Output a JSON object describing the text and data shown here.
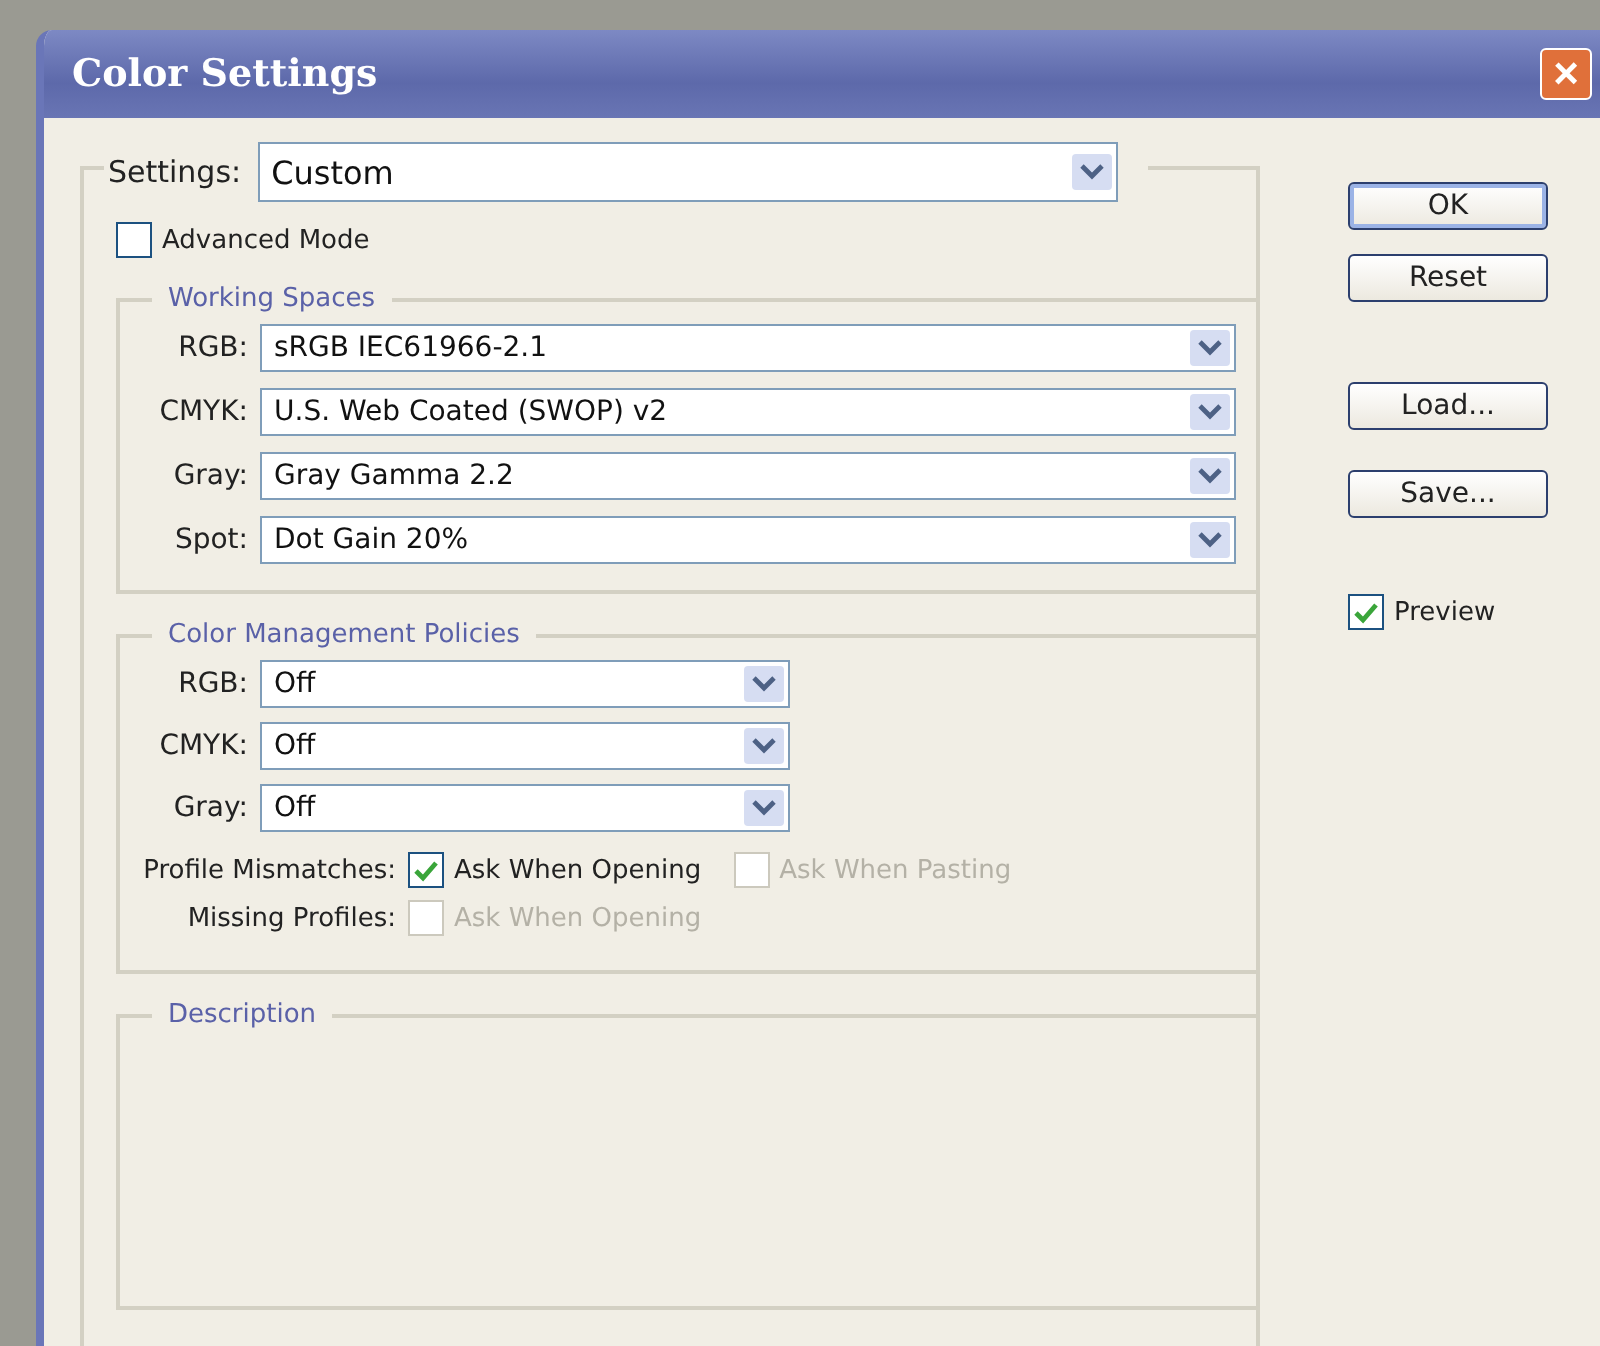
{
  "window": {
    "title": "Color Settings",
    "close": "×"
  },
  "settings": {
    "label": "Settings:",
    "value": "Custom"
  },
  "advanced_mode": {
    "label": "Advanced Mode",
    "checked": false
  },
  "working_spaces": {
    "title": "Working Spaces",
    "rows": [
      {
        "label": "RGB:",
        "value": "sRGB IEC61966-2.1"
      },
      {
        "label": "CMYK:",
        "value": "U.S. Web Coated (SWOP) v2"
      },
      {
        "label": "Gray:",
        "value": "Gray Gamma 2.2"
      },
      {
        "label": "Spot:",
        "value": "Dot Gain 20%"
      }
    ]
  },
  "policies": {
    "title": "Color Management Policies",
    "rows": [
      {
        "label": "RGB:",
        "value": "Off"
      },
      {
        "label": "CMYK:",
        "value": "Off"
      },
      {
        "label": "Gray:",
        "value": "Off"
      }
    ],
    "options": [
      {
        "label": "Profile Mismatches:",
        "checks": [
          {
            "label": "Ask When Opening",
            "checked": true,
            "disabled": false
          },
          {
            "label": "Ask When Pasting",
            "checked": false,
            "disabled": true
          }
        ]
      },
      {
        "label": "Missing Profiles:",
        "checks": [
          {
            "label": "Ask When Opening",
            "checked": false,
            "disabled": true
          }
        ]
      }
    ]
  },
  "description": {
    "title": "Description"
  },
  "buttons": [
    {
      "label": "OK",
      "default": true
    },
    {
      "label": "Reset",
      "default": false
    },
    {
      "label": "Load...",
      "default": false
    },
    {
      "label": "Save...",
      "default": false
    }
  ],
  "preview": {
    "label": "Preview",
    "checked": true
  }
}
